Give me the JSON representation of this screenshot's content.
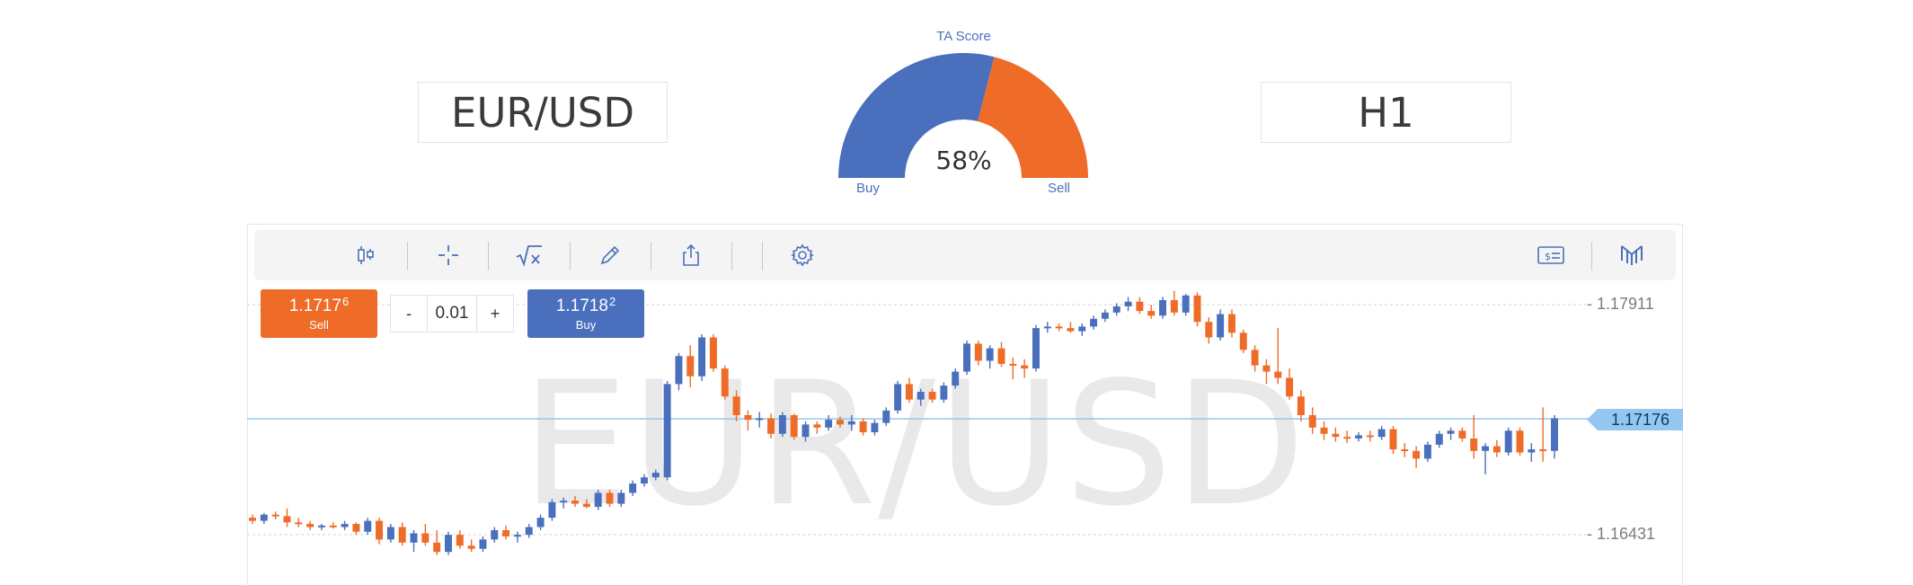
{
  "instrument": {
    "pair": "EUR/USD",
    "timeframe": "H1"
  },
  "gauge": {
    "title": "TA Score",
    "value_label": "58%",
    "buy_fraction": 0.58,
    "buy_label": "Buy",
    "sell_label": "Sell",
    "buy_color": "#4a70bd",
    "sell_color": "#ee6c27"
  },
  "toolbar": {
    "left_icons": [
      "candlestick-icon",
      "crosshair-icon",
      "indicators-icon",
      "pencil-icon",
      "share-icon",
      "settings-icon"
    ],
    "right_icons": [
      "quote-icon",
      "brand-logo-icon"
    ]
  },
  "trade": {
    "sell_price": "1.1717",
    "sell_pip": "6",
    "sell_label": "Sell",
    "buy_price": "1.1718",
    "buy_pip": "2",
    "buy_label": "Buy",
    "qty_minus": "-",
    "qty_value": "0.01",
    "qty_plus": "+"
  },
  "chart": {
    "watermark": "EUR/USD",
    "axis_top": "- 1.17911",
    "axis_bottom": "- 1.16431",
    "current_price": "1.17176",
    "up_color": "#4a70bd",
    "down_color": "#ee6c27",
    "current_line_color": "#93c6f0"
  },
  "chart_data": {
    "type": "candlestick",
    "ylim": [
      1.163,
      1.18
    ],
    "gridlines": [
      1.17911,
      1.16431
    ],
    "current": 1.17176,
    "candles": [
      [
        1.1654,
        1.1656,
        1.165,
        1.1652
      ],
      [
        1.1652,
        1.1657,
        1.165,
        1.1656
      ],
      [
        1.1656,
        1.1658,
        1.1653,
        1.1655
      ],
      [
        1.1655,
        1.166,
        1.1648,
        1.1651
      ],
      [
        1.1651,
        1.1654,
        1.1648,
        1.165
      ],
      [
        1.165,
        1.1652,
        1.1646,
        1.1648
      ],
      [
        1.1648,
        1.165,
        1.1646,
        1.1649
      ],
      [
        1.1649,
        1.1651,
        1.1647,
        1.1648
      ],
      [
        1.1648,
        1.1652,
        1.1646,
        1.165
      ],
      [
        1.165,
        1.1651,
        1.1643,
        1.1645
      ],
      [
        1.1645,
        1.1654,
        1.1643,
        1.1652
      ],
      [
        1.1652,
        1.1654,
        1.1637,
        1.164
      ],
      [
        1.164,
        1.165,
        1.1638,
        1.1648
      ],
      [
        1.1648,
        1.1651,
        1.1636,
        1.1638
      ],
      [
        1.1638,
        1.1646,
        1.1632,
        1.1644
      ],
      [
        1.1644,
        1.165,
        1.1636,
        1.1638
      ],
      [
        1.1638,
        1.1646,
        1.163,
        1.1632
      ],
      [
        1.1632,
        1.1645,
        1.163,
        1.1643
      ],
      [
        1.1643,
        1.1646,
        1.1634,
        1.1636
      ],
      [
        1.1636,
        1.164,
        1.1632,
        1.1634
      ],
      [
        1.1634,
        1.1642,
        1.1632,
        1.164
      ],
      [
        1.164,
        1.1648,
        1.1638,
        1.1646
      ],
      [
        1.1646,
        1.1649,
        1.164,
        1.1642
      ],
      [
        1.1642,
        1.1645,
        1.1638,
        1.1643
      ],
      [
        1.1643,
        1.165,
        1.1641,
        1.1648
      ],
      [
        1.1648,
        1.1656,
        1.1646,
        1.1654
      ],
      [
        1.1654,
        1.1666,
        1.1652,
        1.1664
      ],
      [
        1.1664,
        1.1667,
        1.166,
        1.1665
      ],
      [
        1.1665,
        1.1668,
        1.1661,
        1.1663
      ],
      [
        1.1663,
        1.1666,
        1.166,
        1.1661
      ],
      [
        1.1661,
        1.1672,
        1.1659,
        1.167
      ],
      [
        1.167,
        1.1672,
        1.1661,
        1.1663
      ],
      [
        1.1663,
        1.1672,
        1.1661,
        1.167
      ],
      [
        1.167,
        1.1678,
        1.1668,
        1.1676
      ],
      [
        1.1676,
        1.1682,
        1.1674,
        1.168
      ],
      [
        1.168,
        1.1685,
        1.1678,
        1.1683
      ],
      [
        1.168,
        1.1742,
        1.1678,
        1.174
      ],
      [
        1.174,
        1.176,
        1.1736,
        1.1758
      ],
      [
        1.1758,
        1.1765,
        1.1738,
        1.1745
      ],
      [
        1.1745,
        1.1772,
        1.1742,
        1.177
      ],
      [
        1.177,
        1.1772,
        1.1748,
        1.175
      ],
      [
        1.175,
        1.1752,
        1.173,
        1.1732
      ],
      [
        1.1732,
        1.1736,
        1.1716,
        1.172
      ],
      [
        1.172,
        1.1723,
        1.171,
        1.1717
      ],
      [
        1.1717,
        1.1722,
        1.1712,
        1.1718
      ],
      [
        1.1718,
        1.1721,
        1.1705,
        1.1708
      ],
      [
        1.1708,
        1.1722,
        1.1706,
        1.172
      ],
      [
        1.172,
        1.1721,
        1.1704,
        1.1706
      ],
      [
        1.1706,
        1.1716,
        1.1703,
        1.1714
      ],
      [
        1.1714,
        1.1716,
        1.1708,
        1.1712
      ],
      [
        1.1712,
        1.172,
        1.171,
        1.1717
      ],
      [
        1.1717,
        1.1719,
        1.1712,
        1.1714
      ],
      [
        1.1714,
        1.172,
        1.171,
        1.1716
      ],
      [
        1.1716,
        1.1718,
        1.1707,
        1.1709
      ],
      [
        1.1709,
        1.1717,
        1.1707,
        1.1715
      ],
      [
        1.1715,
        1.1725,
        1.1713,
        1.1723
      ],
      [
        1.1723,
        1.1742,
        1.1721,
        1.174
      ],
      [
        1.174,
        1.1744,
        1.1728,
        1.173
      ],
      [
        1.173,
        1.1737,
        1.1726,
        1.1735
      ],
      [
        1.1735,
        1.1737,
        1.1728,
        1.173
      ],
      [
        1.173,
        1.1741,
        1.1728,
        1.1739
      ],
      [
        1.1739,
        1.175,
        1.1737,
        1.1748
      ],
      [
        1.1748,
        1.1768,
        1.1746,
        1.1766
      ],
      [
        1.1766,
        1.1768,
        1.1752,
        1.1755
      ],
      [
        1.1755,
        1.1765,
        1.175,
        1.1763
      ],
      [
        1.1763,
        1.1767,
        1.1751,
        1.1753
      ],
      [
        1.1753,
        1.1757,
        1.1743,
        1.1752
      ],
      [
        1.1752,
        1.1756,
        1.1744,
        1.175
      ],
      [
        1.175,
        1.1778,
        1.1748,
        1.1776
      ],
      [
        1.1776,
        1.178,
        1.1773,
        1.1777
      ],
      [
        1.1777,
        1.1779,
        1.1774,
        1.1776
      ],
      [
        1.1776,
        1.178,
        1.1773,
        1.1774
      ],
      [
        1.1774,
        1.1779,
        1.1771,
        1.1777
      ],
      [
        1.1777,
        1.1784,
        1.1775,
        1.1782
      ],
      [
        1.1782,
        1.1788,
        1.178,
        1.1786
      ],
      [
        1.1786,
        1.1792,
        1.1784,
        1.179
      ],
      [
        1.179,
        1.1796,
        1.1787,
        1.1793
      ],
      [
        1.1793,
        1.1796,
        1.1785,
        1.1787
      ],
      [
        1.1787,
        1.1791,
        1.1782,
        1.1784
      ],
      [
        1.1784,
        1.1796,
        1.1782,
        1.1794
      ],
      [
        1.1794,
        1.18,
        1.1784,
        1.1786
      ],
      [
        1.1786,
        1.1798,
        1.1784,
        1.1797
      ],
      [
        1.1797,
        1.1799,
        1.1777,
        1.178
      ],
      [
        1.178,
        1.1783,
        1.1766,
        1.177
      ],
      [
        1.177,
        1.1788,
        1.1768,
        1.1785
      ],
      [
        1.1785,
        1.1788,
        1.177,
        1.1773
      ],
      [
        1.1773,
        1.1775,
        1.176,
        1.1762
      ],
      [
        1.1762,
        1.1765,
        1.1748,
        1.1752
      ],
      [
        1.1752,
        1.1756,
        1.174,
        1.1748
      ],
      [
        1.1748,
        1.1776,
        1.174,
        1.1744
      ],
      [
        1.1744,
        1.175,
        1.173,
        1.1732
      ],
      [
        1.1732,
        1.1736,
        1.1716,
        1.172
      ],
      [
        1.172,
        1.1725,
        1.1708,
        1.1712
      ],
      [
        1.1712,
        1.1716,
        1.1704,
        1.1708
      ],
      [
        1.1708,
        1.1712,
        1.1703,
        1.1706
      ],
      [
        1.1706,
        1.171,
        1.1702,
        1.1705
      ],
      [
        1.1705,
        1.1709,
        1.1703,
        1.1707
      ],
      [
        1.1707,
        1.171,
        1.1703,
        1.1706
      ],
      [
        1.1706,
        1.1713,
        1.1704,
        1.1711
      ],
      [
        1.1711,
        1.1713,
        1.1695,
        1.1698
      ],
      [
        1.1698,
        1.1702,
        1.1693,
        1.1697
      ],
      [
        1.1697,
        1.17,
        1.1686,
        1.1692
      ],
      [
        1.1692,
        1.1703,
        1.169,
        1.1701
      ],
      [
        1.1701,
        1.171,
        1.1699,
        1.1708
      ],
      [
        1.1708,
        1.1712,
        1.1704,
        1.171
      ],
      [
        1.171,
        1.1712,
        1.1703,
        1.1705
      ],
      [
        1.1705,
        1.172,
        1.1692,
        1.1697
      ],
      [
        1.1697,
        1.1702,
        1.1682,
        1.17
      ],
      [
        1.17,
        1.1704,
        1.1693,
        1.1696
      ],
      [
        1.1696,
        1.1712,
        1.1694,
        1.171
      ],
      [
        1.171,
        1.1712,
        1.1694,
        1.1696
      ],
      [
        1.1696,
        1.1702,
        1.169,
        1.1698
      ],
      [
        1.1698,
        1.1725,
        1.169,
        1.1697
      ],
      [
        1.1697,
        1.172,
        1.1692,
        1.1718
      ]
    ]
  }
}
